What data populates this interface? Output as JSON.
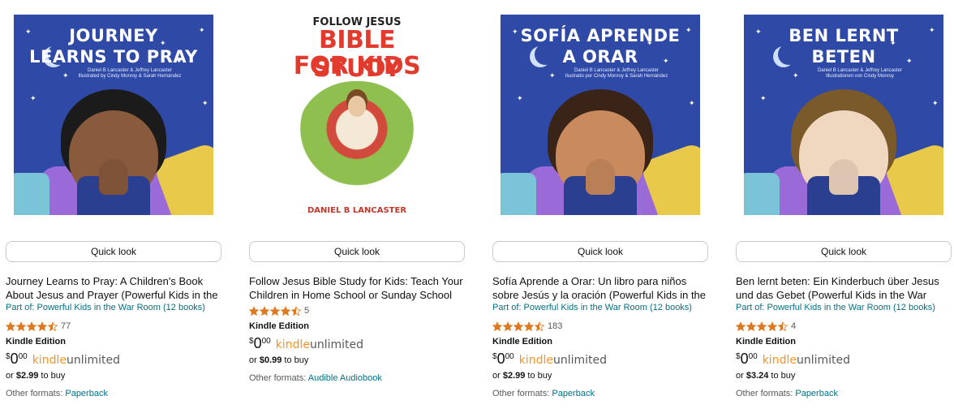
{
  "accent": "#007185",
  "star_color": "#de7921",
  "products": [
    {
      "cover": {
        "style": "blue",
        "title_lines": [
          "JOURNEY",
          "LEARNS TO PRAY"
        ],
        "author_lines": [
          "Daniel B Lancaster & Jeffrey Lancaster",
          "Illustrated by Cindy Monroy & Sarah Hernández"
        ],
        "skin": "#8a5a3c",
        "hair": "#1b1b1b"
      },
      "quick_look": "Quick look",
      "title": "Journey Learns to Pray: A Children's Book About Jesus and Prayer (Powerful Kids in the War Room)",
      "series": "Part of: Powerful Kids in the War Room (12 books)",
      "rating": 4.5,
      "rating_count": "77",
      "edition": "Kindle Edition",
      "price": {
        "symbol": "$",
        "whole": "0",
        "fraction": "00"
      },
      "kindle_unlimited": {
        "kindle": "kindle",
        "unlimited": "unlimited"
      },
      "buy_prefix": "or ",
      "buy_price": "$2.99",
      "buy_suffix": " to buy",
      "other_formats_label": "Other formats: ",
      "other_formats_link": "Paperback"
    },
    {
      "cover": {
        "style": "white",
        "title_top": "FOLLOW JESUS",
        "title_lines": [
          "BIBLE STUDY",
          "FOR KIDS"
        ],
        "author": "DANIEL B LANCASTER"
      },
      "quick_look": "Quick look",
      "title": "Follow Jesus Bible Study for Kids: Teach Your Children in Home School or Sunday School with Real Stories",
      "series": "",
      "rating": 4.5,
      "rating_count": "5",
      "edition": "Kindle Edition",
      "price": {
        "symbol": "$",
        "whole": "0",
        "fraction": "00"
      },
      "kindle_unlimited": {
        "kindle": "kindle",
        "unlimited": "unlimited"
      },
      "buy_prefix": "or ",
      "buy_price": "$0.99",
      "buy_suffix": " to buy",
      "other_formats_label": "Other formats: ",
      "other_formats_link": "Audible Audiobook"
    },
    {
      "cover": {
        "style": "blue",
        "title_lines": [
          "SOFÍA APRENDE",
          "A ORAR"
        ],
        "author_lines": [
          "Daniel B Lancaster & Jeffrey Lancaster",
          "Ilustrado por Cindy Monroy & Sarah Hernández"
        ],
        "skin": "#c98a5e",
        "hair": "#3a2418"
      },
      "quick_look": "Quick look",
      "title": "Sofía Aprende a Orar: Un libro para niños sobre Jesús y la oración (Powerful Kids in the War Room)",
      "series": "Part of: Powerful Kids in the War Room (12 books)",
      "rating": 4.5,
      "rating_count": "183",
      "edition": "Kindle Edition",
      "price": {
        "symbol": "$",
        "whole": "0",
        "fraction": "00"
      },
      "kindle_unlimited": {
        "kindle": "kindle",
        "unlimited": "unlimited"
      },
      "buy_prefix": "or ",
      "buy_price": "$2.99",
      "buy_suffix": " to buy",
      "other_formats_label": "Other formats: ",
      "other_formats_link": "Paperback"
    },
    {
      "cover": {
        "style": "blue",
        "title_lines": [
          "BEN LERNT",
          "BETEN"
        ],
        "author_lines": [
          "Daniel B Lancaster & Jeffrey Lancaster",
          "Illustrationen von Cindy Monroy"
        ],
        "skin": "#f0d7c0",
        "hair": "#7a5a2a"
      },
      "quick_look": "Quick look",
      "title": "Ben lernt beten: Ein Kinderbuch über Jesus und das Gebet (Powerful Kids in the War Room)",
      "series": "Part of: Powerful Kids in the War Room (12 books)",
      "rating": 4.5,
      "rating_count": "4",
      "edition": "Kindle Edition",
      "price": {
        "symbol": "$",
        "whole": "0",
        "fraction": "00"
      },
      "kindle_unlimited": {
        "kindle": "kindle",
        "unlimited": "unlimited"
      },
      "buy_prefix": "or ",
      "buy_price": "$3.24",
      "buy_suffix": " to buy",
      "other_formats_label": "Other formats: ",
      "other_formats_link": "Paperback"
    }
  ]
}
